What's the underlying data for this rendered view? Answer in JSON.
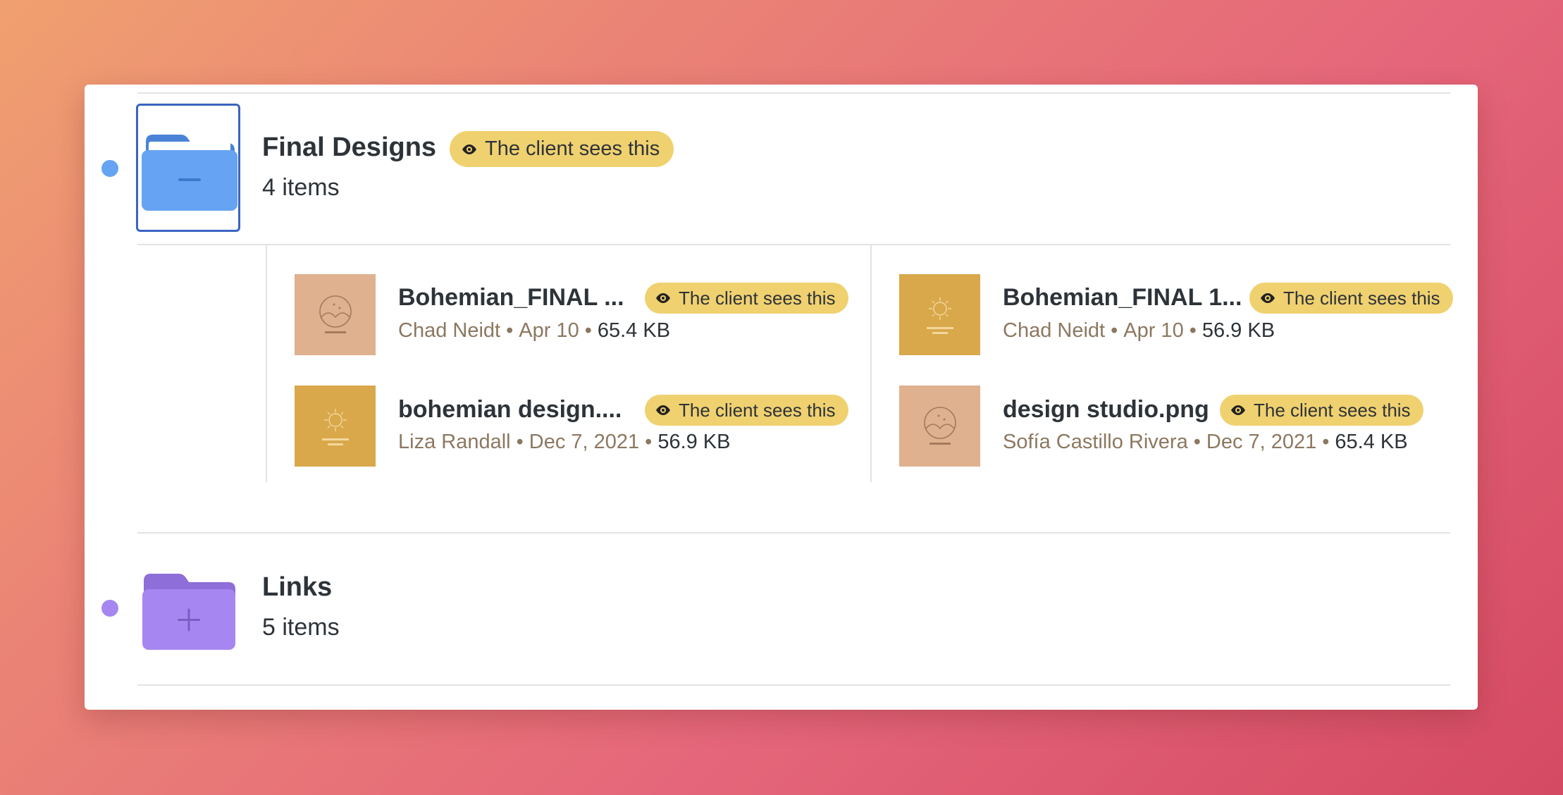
{
  "folders": [
    {
      "title": "Final Designs",
      "count": "4 items",
      "badge": "The client sees this",
      "icon": "folder-minus-icon",
      "color": "#66a3f2",
      "dot_color": "#66a3f2"
    },
    {
      "title": "Links",
      "count": "5 items",
      "icon": "folder-plus-icon",
      "color": "#a687f2",
      "dot_color": "#a687f2"
    }
  ],
  "files": [
    {
      "name": "Bohemian_FINAL ...",
      "author": "Chad Neidt",
      "date": "Apr 10",
      "size": "65.4 KB",
      "badge": "The client sees this",
      "thumb": "peach-logo",
      "thumb_color": "#dfb18f"
    },
    {
      "name": "Bohemian_FINAL 1...",
      "author": "Chad Neidt",
      "date": "Apr 10",
      "size": "56.9 KB",
      "badge": "The client sees this",
      "thumb": "gold-logo",
      "thumb_color": "#d8a84b"
    },
    {
      "name": "bohemian design....",
      "author": "Liza Randall",
      "date": "Dec 7, 2021",
      "size": "56.9 KB",
      "badge": "The client sees this",
      "thumb": "gold-logo",
      "thumb_color": "#d8a84b"
    },
    {
      "name": "design studio.png",
      "author": "Sofía Castillo Rivera",
      "date": "Dec 7, 2021",
      "size": "65.4 KB",
      "badge": "The client sees this",
      "thumb": "peach-logo",
      "thumb_color": "#dfb18f"
    }
  ],
  "separator": "•",
  "colors": {
    "badge_bg": "#f0d170",
    "selection_border": "#3a64c2",
    "meta_text": "#8c7860"
  }
}
